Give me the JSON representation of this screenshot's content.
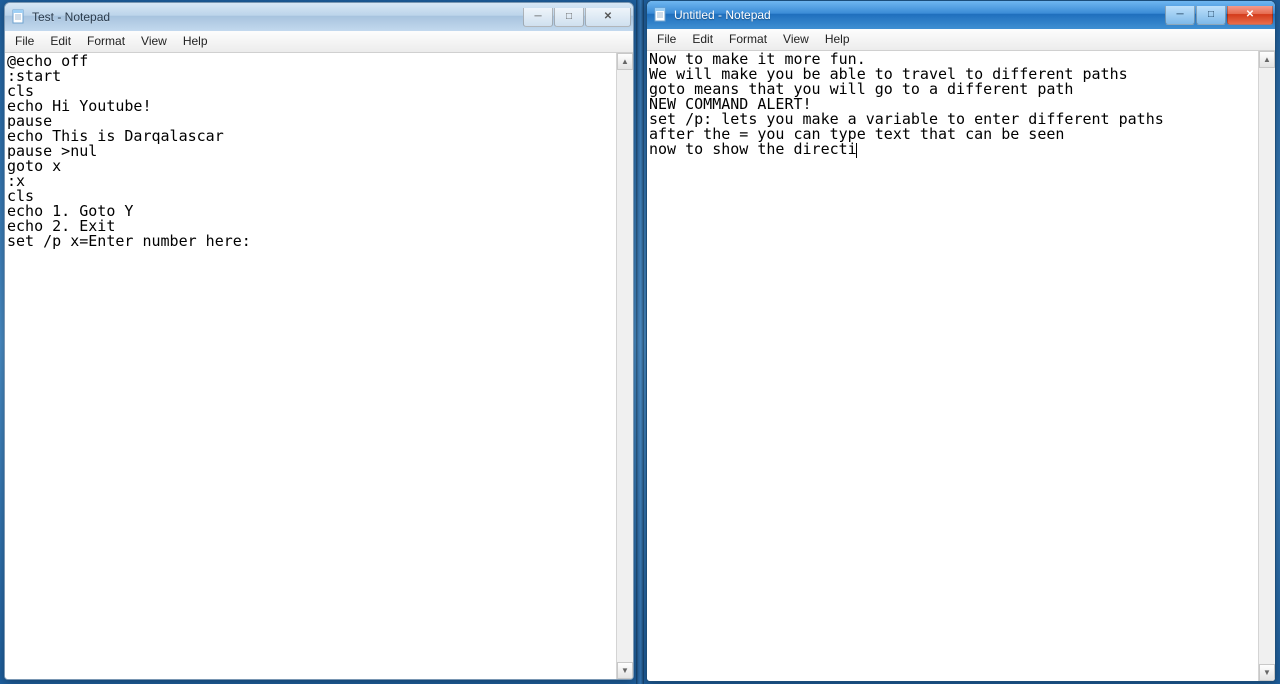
{
  "left_window": {
    "title": "Test - Notepad",
    "active": false,
    "menubar": [
      "File",
      "Edit",
      "Format",
      "View",
      "Help"
    ],
    "content": "@echo off\n:start\ncls\necho Hi Youtube!\npause\necho This is Darqalascar\npause >nul\ngoto x\n:x\ncls\necho 1. Goto Y\necho 2. Exit\nset /p x=Enter number here:"
  },
  "right_window": {
    "title": "Untitled - Notepad",
    "active": true,
    "menubar": [
      "File",
      "Edit",
      "Format",
      "View",
      "Help"
    ],
    "content": "Now to make it more fun.\nWe will make you be able to travel to different paths\ngoto means that you will go to a different path\nNEW COMMAND ALERT!\nset /p: lets you make a variable to enter different paths\nafter the = you can type text that can be seen\nnow to show the directi"
  },
  "win_controls": {
    "minimize_glyph": "─",
    "maximize_glyph": "□",
    "close_glyph": "✕"
  }
}
